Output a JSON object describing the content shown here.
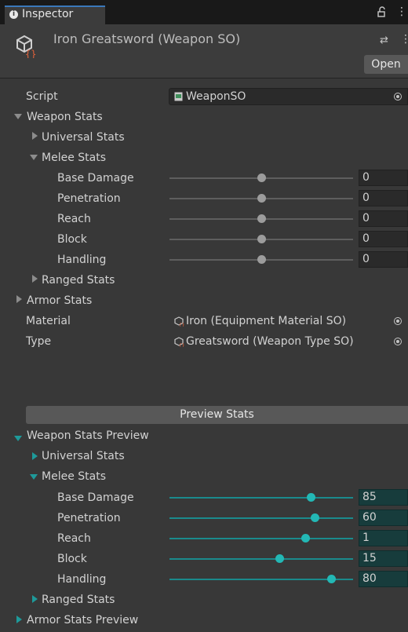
{
  "tab": {
    "label": "Inspector"
  },
  "header": {
    "title": "Iron Greatsword (Weapon SO)",
    "open_label": "Open"
  },
  "script_row": {
    "label": "Script",
    "value": "WeaponSO"
  },
  "weapon_stats": {
    "label": "Weapon Stats",
    "universal_label": "Universal Stats",
    "melee_label": "Melee Stats",
    "ranged_label": "Ranged Stats",
    "melee": [
      {
        "label": "Base Damage",
        "value": "0",
        "slider": 0.5
      },
      {
        "label": "Penetration",
        "value": "0",
        "slider": 0.5
      },
      {
        "label": "Reach",
        "value": "0",
        "slider": 0.5
      },
      {
        "label": "Block",
        "value": "0",
        "slider": 0.5
      },
      {
        "label": "Handling",
        "value": "0",
        "slider": 0.5
      }
    ]
  },
  "armor_stats": {
    "label": "Armor Stats"
  },
  "material": {
    "label": "Material",
    "value": "Iron (Equipment Material SO)"
  },
  "type": {
    "label": "Type",
    "value": "Greatsword (Weapon Type SO)"
  },
  "preview_button": {
    "label": "Preview Stats"
  },
  "preview": {
    "label": "Weapon Stats Preview",
    "universal_label": "Universal Stats",
    "melee_label": "Melee Stats",
    "ranged_label": "Ranged Stats",
    "melee": [
      {
        "label": "Base Damage",
        "value": "85",
        "slider": 0.77
      },
      {
        "label": "Penetration",
        "value": "60",
        "slider": 0.79
      },
      {
        "label": "Reach",
        "value": "1",
        "slider": 0.74
      },
      {
        "label": "Block",
        "value": "15",
        "slider": 0.6
      },
      {
        "label": "Handling",
        "value": "80",
        "slider": 0.88
      }
    ]
  },
  "armor_preview": {
    "label": "Armor Stats Preview"
  },
  "colors": {
    "background": "#383838",
    "accent": "#23b8b5",
    "tab_highlight": "#3a79bb"
  },
  "icons": [
    "info-icon",
    "lock-icon",
    "menu-icon",
    "scriptable-object-icon",
    "preset-icon",
    "script-file-icon",
    "object-picker-icon"
  ]
}
